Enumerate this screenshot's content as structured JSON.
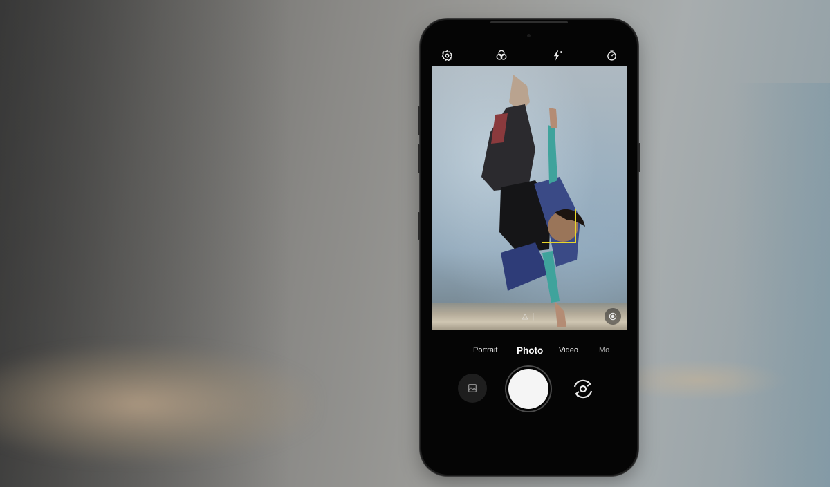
{
  "camera_app": {
    "top_bar": {
      "icons": [
        "settings-icon",
        "filters-icon",
        "flash-auto-icon",
        "timer-icon"
      ]
    },
    "viewfinder": {
      "subject": "photo-preview",
      "focus_indicator": "face-detection-box",
      "lens_switch_icon": "lens-switch-icon"
    },
    "modes": [
      {
        "label": "Portrait",
        "active": false
      },
      {
        "label": "Photo",
        "active": true
      },
      {
        "label": "Video",
        "active": false
      },
      {
        "label": "Mo",
        "active": false
      }
    ],
    "controls": {
      "gallery_icon": "gallery-thumbnail-icon",
      "shutter": "shutter-button",
      "flip_icon": "flip-camera-icon"
    },
    "colors": {
      "focus_box": "#e7d62a",
      "phone_body": "#050505",
      "shutter": "#f5f5f5"
    }
  }
}
